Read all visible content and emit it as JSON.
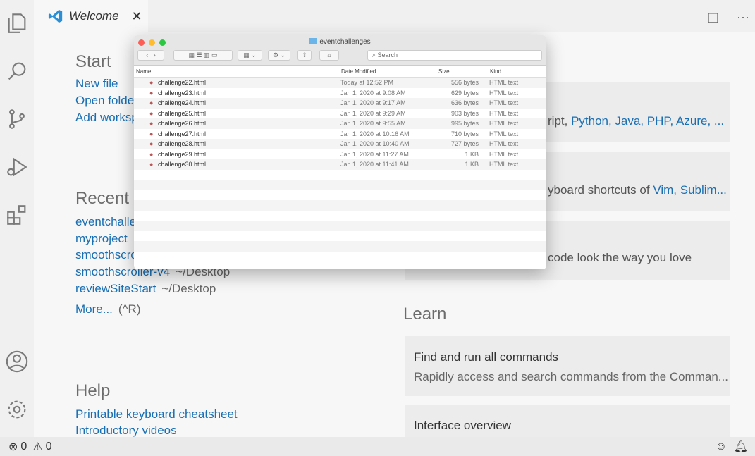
{
  "tab": {
    "title": "Welcome"
  },
  "start": {
    "heading": "Start",
    "links": [
      "New file",
      "Open folde",
      "Add worksp"
    ]
  },
  "recent": {
    "heading": "Recent",
    "items": [
      {
        "name": "eventchalle",
        "path": ""
      },
      {
        "name": "myproject",
        "path": ""
      },
      {
        "name": "smoothscro",
        "path": ""
      },
      {
        "name": "smoothscroller-v4",
        "path": "~/Desktop"
      },
      {
        "name": "reviewSiteStart",
        "path": "~/Desktop"
      }
    ],
    "more": "More...",
    "more_shortcut": "(^R)"
  },
  "help": {
    "heading": "Help",
    "links": [
      "Printable keyboard cheatsheet",
      "Introductory videos"
    ]
  },
  "customize": {
    "card1_prefix": "ript, ",
    "card1_links": "Python, Java, PHP, Azure, ...",
    "card2_prefix": "yboard shortcuts of ",
    "card2_links": "Vim, Sublim...",
    "card3": "code look the way you love"
  },
  "learn": {
    "heading": "Learn",
    "cards": [
      {
        "title": "Find and run all commands",
        "desc": "Rapidly access and search commands from the Comman..."
      },
      {
        "title": "Interface overview",
        "desc": ""
      }
    ]
  },
  "status": {
    "errors": "0",
    "warnings": "0"
  },
  "finder": {
    "title": "eventchallenges",
    "search_placeholder": "Search",
    "columns": [
      "Name",
      "Date Modified",
      "Size",
      "Kind"
    ],
    "files": [
      [
        "challenge22.html",
        "Today at 12:52 PM",
        "556 bytes",
        "HTML text"
      ],
      [
        "challenge23.html",
        "Jan 1, 2020 at 9:08 AM",
        "629 bytes",
        "HTML text"
      ],
      [
        "challenge24.html",
        "Jan 1, 2020 at 9:17 AM",
        "636 bytes",
        "HTML text"
      ],
      [
        "challenge25.html",
        "Jan 1, 2020 at 9:29 AM",
        "903 bytes",
        "HTML text"
      ],
      [
        "challenge26.html",
        "Jan 1, 2020 at 9:55 AM",
        "995 bytes",
        "HTML text"
      ],
      [
        "challenge27.html",
        "Jan 1, 2020 at 10:16 AM",
        "710 bytes",
        "HTML text"
      ],
      [
        "challenge28.html",
        "Jan 1, 2020 at 10:40 AM",
        "727 bytes",
        "HTML text"
      ],
      [
        "challenge29.html",
        "Jan 1, 2020 at 11:27 AM",
        "1 KB",
        "HTML text"
      ],
      [
        "challenge30.html",
        "Jan 1, 2020 at 11:41 AM",
        "1 KB",
        "HTML text"
      ]
    ]
  },
  "colors": {
    "link": "#1a6fb3",
    "vscode_logo": "#2b8fd6"
  }
}
